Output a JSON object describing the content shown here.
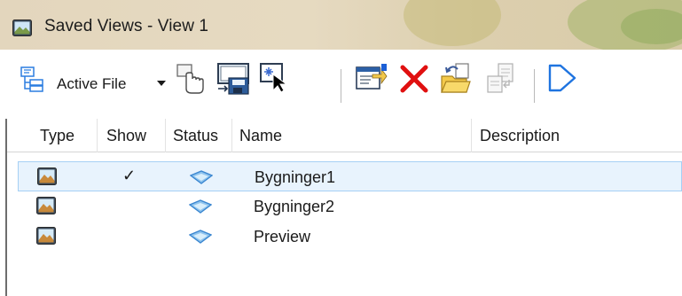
{
  "window": {
    "title": "Saved Views - View 1",
    "icon": "saved-view-icon"
  },
  "toolbar": {
    "file_filter_label": "Active File",
    "buttons": [
      {
        "name": "file-filter-icon"
      },
      {
        "name": "filter-dropdown-icon"
      },
      {
        "name": "apply-view-icon"
      },
      {
        "name": "save-view-icon"
      },
      {
        "name": "select-view-icon"
      },
      {
        "name": "properties-icon"
      },
      {
        "name": "delete-icon"
      },
      {
        "name": "import-icon"
      },
      {
        "name": "export-icon"
      },
      {
        "name": "preview-icon"
      }
    ]
  },
  "table": {
    "columns": [
      "Type",
      "Show",
      "Status",
      "Name",
      "Description"
    ],
    "rows": [
      {
        "type_icon": "view-type-icon",
        "show": "✓",
        "status_icon": "status-view-icon",
        "name": "Bygninger1",
        "description": "",
        "selected": true
      },
      {
        "type_icon": "view-type-icon",
        "show": "",
        "status_icon": "status-view-icon",
        "name": "Bygninger2",
        "description": "",
        "selected": false
      },
      {
        "type_icon": "view-type-icon",
        "show": "",
        "status_icon": "status-view-icon",
        "name": "Preview",
        "description": "",
        "selected": false
      }
    ]
  },
  "colors": {
    "selection_bg": "#e8f3fd",
    "selection_border": "#a6d0f5",
    "delete_red": "#e01010",
    "accent_blue": "#2b7de0"
  }
}
